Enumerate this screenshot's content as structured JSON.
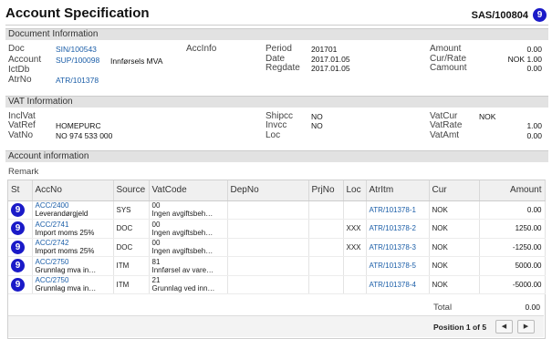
{
  "header": {
    "title": "Account Specification",
    "doc_ref": "SAS/100804",
    "status_badge": "9"
  },
  "document_info": {
    "section_title": "Document Information",
    "doc_label": "Doc",
    "doc_value": "SIN/100543",
    "account_label": "Account",
    "account_value": "SUP/100098",
    "account_name": "Innførsels MVA",
    "ictdb_label": "IctDb",
    "atrno_label": "AtrNo",
    "atrno_value": "ATR/101378",
    "accinfo_label": "AccInfo",
    "period_label": "Period",
    "period_value": "201701",
    "date_label": "Date",
    "date_value": "2017.01.05",
    "regdate_label": "Regdate",
    "regdate_value": "2017.01.05",
    "amount_label": "Amount",
    "amount_value": "0.00",
    "currate_label": "Cur/Rate",
    "currate_value": "NOK 1.00",
    "camount_label": "Camount",
    "camount_value": "0.00"
  },
  "vat_info": {
    "section_title": "VAT Information",
    "inclvat_label": "InclVat",
    "vatref_label": "VatRef",
    "vatref_value": "HOMEPURC",
    "vatno_label": "VatNo",
    "vatno_value": "NO 974 533 000",
    "shipcc_label": "Shipcc",
    "shipcc_value": "NO",
    "invcc_label": "Invcc",
    "invcc_value": "NO",
    "loc_label": "Loc",
    "vatcur_label": "VatCur",
    "vatcur_value": "NOK",
    "vatrate_label": "VatRate",
    "vatrate_value": "1.00",
    "vatamt_label": "VatAmt",
    "vatamt_value": "0.00"
  },
  "account_info": {
    "section_title": "Account information",
    "remark_label": "Remark",
    "columns": [
      "St",
      "AccNo",
      "Source",
      "VatCode",
      "DepNo",
      "PrjNo",
      "Loc",
      "AtrItm",
      "Cur",
      "Amount"
    ],
    "rows": [
      {
        "st": "9",
        "acc_code": "ACC/2400",
        "acc_name": "Leverandørgjeld",
        "source": "SYS",
        "vat_code": "00",
        "vat_desc": "Ingen avgiftsbeh…",
        "dep": "",
        "prj": "",
        "loc": "",
        "atritm": "ATR/101378-1",
        "cur": "NOK",
        "amount": "0.00"
      },
      {
        "st": "9",
        "acc_code": "ACC/2741",
        "acc_name": "Import moms 25%",
        "source": "DOC",
        "vat_code": "00",
        "vat_desc": "Ingen avgiftsbeh…",
        "dep": "",
        "prj": "",
        "loc": "XXX",
        "atritm": "ATR/101378-2",
        "cur": "NOK",
        "amount": "1250.00"
      },
      {
        "st": "9",
        "acc_code": "ACC/2742",
        "acc_name": "Import moms 25%",
        "source": "DOC",
        "vat_code": "00",
        "vat_desc": "Ingen avgiftsbeh…",
        "dep": "",
        "prj": "",
        "loc": "XXX",
        "atritm": "ATR/101378-3",
        "cur": "NOK",
        "amount": "-1250.00"
      },
      {
        "st": "9",
        "acc_code": "ACC/2750",
        "acc_name": "Grunnlag mva in…",
        "source": "ITM",
        "vat_code": "81",
        "vat_desc": "Innførsel av vare…",
        "dep": "",
        "prj": "",
        "loc": "",
        "atritm": "ATR/101378-5",
        "cur": "NOK",
        "amount": "5000.00"
      },
      {
        "st": "9",
        "acc_code": "ACC/2750",
        "acc_name": "Grunnlag mva in…",
        "source": "ITM",
        "vat_code": "21",
        "vat_desc": "Grunnlag ved inn…",
        "dep": "",
        "prj": "",
        "loc": "",
        "atritm": "ATR/101378-4",
        "cur": "NOK",
        "amount": "-5000.00"
      }
    ],
    "total_label": "Total",
    "total_value": "0.00",
    "position_text": "Position 1 of 5",
    "prev_icon": "◀",
    "next_icon": "▶"
  },
  "colors": {
    "badge": "#1a1ac8",
    "link": "#1b5ea8",
    "section_bg": "#e2e2e2"
  },
  "icons": {
    "prev": "triangle-left-icon",
    "next": "triangle-right-icon"
  }
}
